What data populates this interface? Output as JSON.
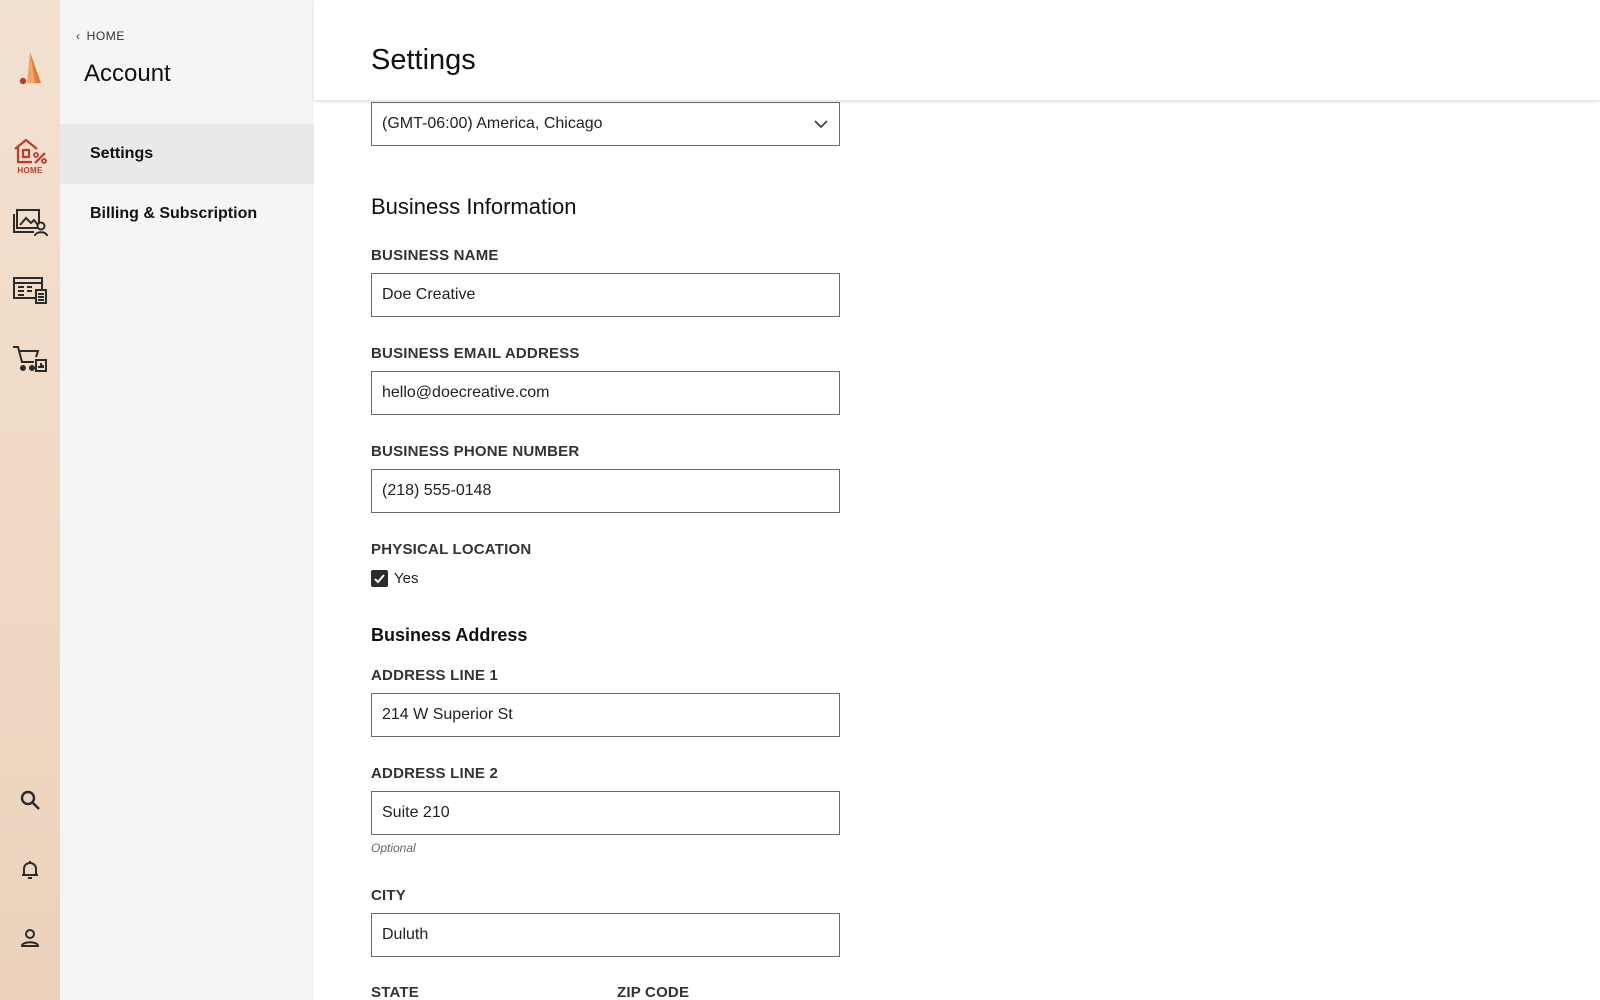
{
  "rail": {
    "home_label": "HOME",
    "brand_color": "#e07b39",
    "accent_color": "#c0392b",
    "icons": [
      "logo-icon",
      "home-icon",
      "gallery-user-icon",
      "invoice-icon",
      "cart-chart-icon",
      "search-icon",
      "bell-icon",
      "user-icon"
    ]
  },
  "subnav": {
    "back_label": "HOME",
    "title": "Account",
    "items": [
      {
        "label": "Settings",
        "active": true
      },
      {
        "label": "Billing & Subscription",
        "active": false
      }
    ]
  },
  "header": {
    "title": "Settings"
  },
  "timezone": {
    "value": "(GMT-06:00) America, Chicago"
  },
  "business_info": {
    "title": "Business Information",
    "name_label": "BUSINESS NAME",
    "name_value": "Doe Creative",
    "email_label": "BUSINESS EMAIL ADDRESS",
    "email_value": "hello@doecreative.com",
    "phone_label": "BUSINESS PHONE NUMBER",
    "phone_value": "(218) 555-0148",
    "physical_location_label": "PHYSICAL LOCATION",
    "physical_location_option": "Yes",
    "physical_location_checked": true
  },
  "business_address": {
    "title": "Business Address",
    "line1_label": "ADDRESS LINE 1",
    "line1_value": "214 W Superior St",
    "line2_label": "ADDRESS LINE 2",
    "line2_value": "Suite 210",
    "line2_hint": "Optional",
    "city_label": "CITY",
    "city_value": "Duluth",
    "state_label": "STATE",
    "zip_label": "ZIP CODE"
  }
}
